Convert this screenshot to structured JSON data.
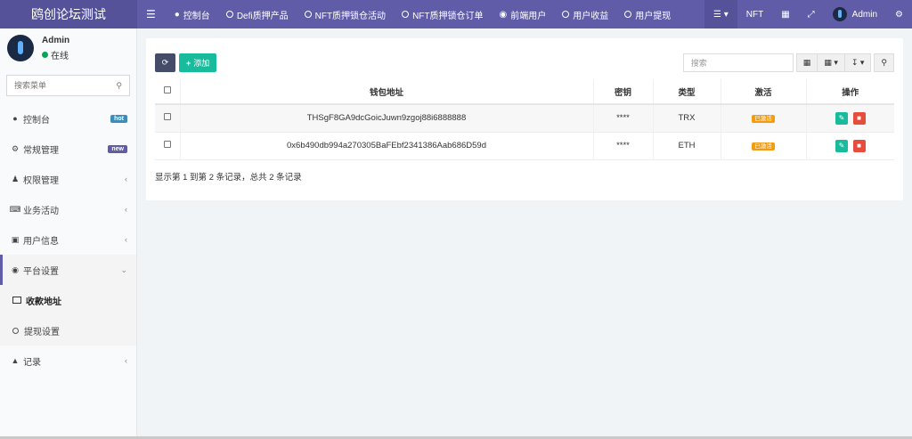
{
  "app": {
    "title": "鸥创论坛测试"
  },
  "topnav": {
    "items": [
      {
        "label": "控制台",
        "icon": "dashboard-icon"
      },
      {
        "label": "Defi质押产品",
        "icon": "circle-icon"
      },
      {
        "label": "NFT质押锁仓活动",
        "icon": "circle-icon"
      },
      {
        "label": "NFT质押锁仓订单",
        "icon": "circle-icon"
      },
      {
        "label": "前端用户",
        "icon": "user-circle-icon"
      },
      {
        "label": "用户收益",
        "icon": "circle-icon"
      },
      {
        "label": "用户提现",
        "icon": "circle-icon"
      }
    ],
    "nft_label": "NFT",
    "admin_label": "Admin"
  },
  "sidebar": {
    "user": {
      "name": "Admin",
      "status": "在线"
    },
    "search_placeholder": "搜索菜单",
    "items": [
      {
        "label": "控制台",
        "badge": "hot"
      },
      {
        "label": "常规管理",
        "badge": "new"
      },
      {
        "label": "权限管理"
      },
      {
        "label": "业务活动"
      },
      {
        "label": "用户信息"
      },
      {
        "label": "平台设置"
      },
      {
        "label": "记录"
      }
    ],
    "subitems": [
      {
        "label": "收款地址"
      },
      {
        "label": "提现设置"
      }
    ]
  },
  "toolbar": {
    "add_label": "添加",
    "search_placeholder": "搜索"
  },
  "table": {
    "headers": [
      "钱包地址",
      "密钥",
      "类型",
      "激活",
      "操作"
    ],
    "rows": [
      {
        "address": "THSgF8GA9dcGoicJuwn9zgoj88i6888888",
        "secret": "****",
        "type": "TRX",
        "status": "已激活"
      },
      {
        "address": "0x6b490db994a270305BaFEbf2341386Aab686D59d",
        "secret": "****",
        "type": "ETH",
        "status": "已激活"
      }
    ]
  },
  "pagination": {
    "info": "显示第 1 到第 2 条记录，总共 2 条记录"
  },
  "colors": {
    "topbar": "#605ca8",
    "add": "#18bc9c",
    "delete": "#e74c3c",
    "badge": "#f39c12"
  }
}
